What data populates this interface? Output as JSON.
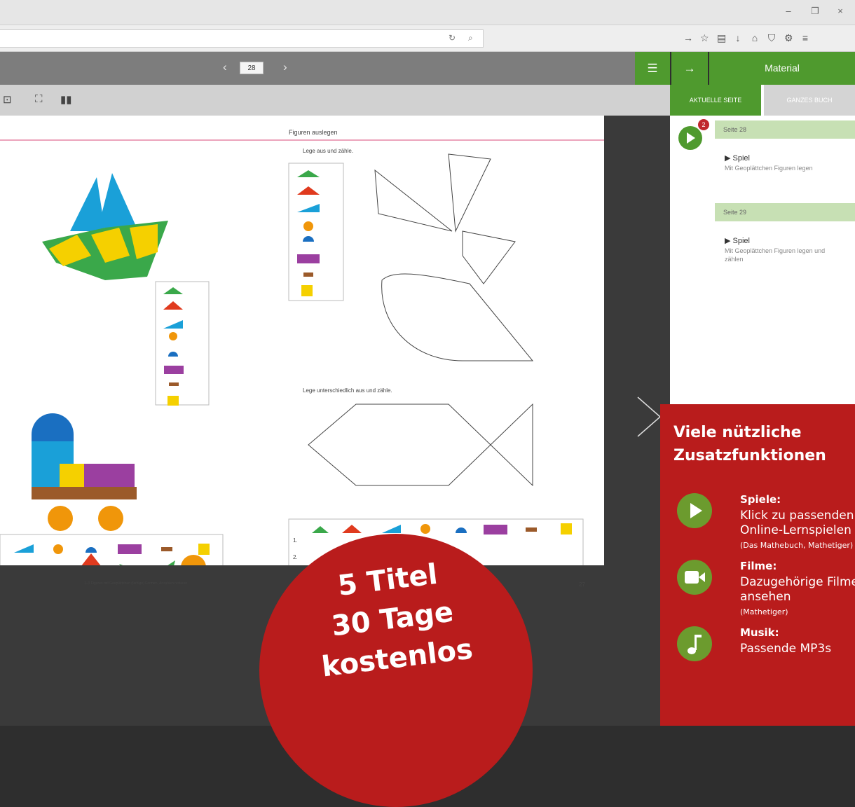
{
  "window": {
    "minimize": "–",
    "restore": "❐",
    "close": "×"
  },
  "browser": {
    "reload_icon": "refresh-icon",
    "search_icon": "search-icon",
    "toolbar_icons": [
      "forward-icon",
      "star-icon",
      "clipboard-icon",
      "download-icon",
      "home-icon",
      "shield-icon",
      "extension-icon",
      "menu-icon"
    ]
  },
  "reader": {
    "page_number": "28",
    "prev": "‹",
    "next": "›",
    "material_label": "Material",
    "tabs": [
      "AKTUELLE SEITE",
      "GANZES BUCH"
    ],
    "badge_count": "2",
    "sections": [
      {
        "page": "Seite 28",
        "title": "Spiel",
        "desc": "Mit Geoplättchen Figuren legen"
      },
      {
        "page": "Seite 29",
        "title": "Spiel",
        "desc": "Mit Geoplättchen Figuren legen und zählen"
      }
    ]
  },
  "book": {
    "heading": "Figuren auslegen",
    "task1": "Lege aus und zähle.",
    "task2": "Lege unterschiedlich aus und zähle.",
    "row1": "1.",
    "row2": "2.",
    "footer_left": "1–3 Figuren mit Geoplättchen (farbige) Formen, Anzahlen notieren",
    "page_num": "27"
  },
  "promo": {
    "headline1": "Viele nützliche",
    "headline2": "Zusatzfunktionen",
    "features": [
      {
        "title": "Spiele:",
        "line1": "Klick zu passenden",
        "line2": "Online-Lernspielen",
        "source": "(Das Mathebuch, Mathetiger)"
      },
      {
        "title": "Filme:",
        "line1": "Dazugehörige Filme",
        "line2": "ansehen",
        "source": "(Mathetiger)"
      },
      {
        "title": "Musik:",
        "line1": "Passende MP3s",
        "line2": "",
        "source": ""
      }
    ],
    "circle_line1": "5 Titel",
    "circle_line2": "30 Tage",
    "circle_line3": "kostenlos"
  },
  "colors": {
    "green": "#4f9a2e",
    "promo_red": "#b91c1c",
    "panel_grey": "#7d7d7d"
  }
}
